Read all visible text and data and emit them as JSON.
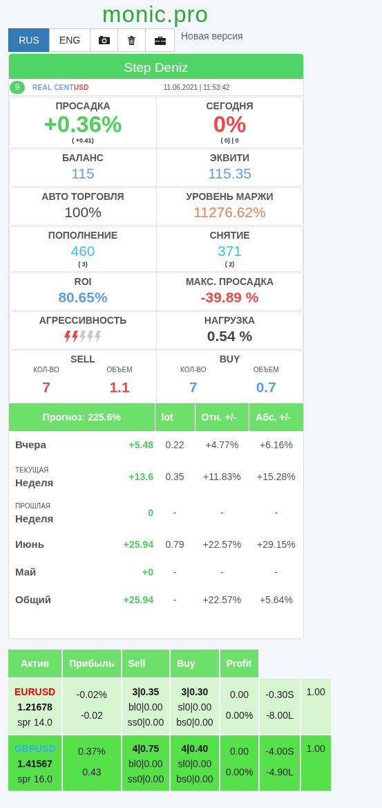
{
  "logo": "monic.pro",
  "toolbar": {
    "languages": [
      {
        "label": "RUS",
        "selected": true
      },
      {
        "label": "ENG",
        "selected": false
      }
    ],
    "link": "Новая версия"
  },
  "account": {
    "name": "Step Deniz",
    "badge": "9",
    "type": "REAL CENT",
    "currency": "USD",
    "datetime": "11.06.2021 | 11:53:42"
  },
  "stats": [
    [
      {
        "kind": "big",
        "label": "ПРОСАДКА",
        "value": "+0.36%",
        "color": "#4cd05a",
        "note": "( +0.41)"
      },
      {
        "kind": "big",
        "label": "СЕГОДНЯ",
        "value": "0%",
        "color": "#f0474b",
        "note": "( 0) | 0"
      }
    ],
    [
      {
        "kind": "value",
        "label": "БАЛАНС",
        "value": "115",
        "color": "#5e9ded"
      },
      {
        "kind": "value",
        "label": "ЭКВИТИ",
        "value": "115.35",
        "color": "#5e9ded"
      }
    ],
    [
      {
        "kind": "value",
        "label": "АВТО ТОРГОВЛЯ",
        "value": "100%",
        "color": "#444444"
      },
      {
        "kind": "value",
        "label": "УРОВЕНЬ МАРЖИ",
        "value": "11276.62%",
        "color": "#f57a55"
      }
    ],
    [
      {
        "kind": "value",
        "label": "ПОПОЛНЕНИЕ",
        "value": "460",
        "color": "#3cc3dc",
        "note": "( 3)"
      },
      {
        "kind": "value",
        "label": "СНЯТИЕ",
        "value": "371",
        "color": "#3cc3dc",
        "note": "( 2)"
      }
    ],
    [
      {
        "kind": "bold",
        "label": "ROI",
        "value": "80.65%",
        "color": "#5e9ded"
      },
      {
        "kind": "bold",
        "label": "МАКС. ПРОСАДКА",
        "value": "-39.89 %",
        "color": "#f0474b"
      }
    ],
    [
      {
        "kind": "bolts",
        "label": "АГРЕССИВНОСТЬ",
        "stars": 2
      },
      {
        "kind": "bold",
        "label": "НАГРУЗКА",
        "value": "0.54 %",
        "color": "#444444"
      }
    ],
    [
      {
        "kind": "orders",
        "label": "SELL",
        "color": "#f0474b",
        "count_label": "КОЛ-ВО",
        "count": "7",
        "volume_label": "ОБЪЕМ",
        "volume": "1.1"
      },
      {
        "kind": "orders",
        "label": "BUY",
        "color": "#5e9ded",
        "count_label": "КОЛ-ВО",
        "count": "7",
        "volume_label": "ОБЪЕМ",
        "volume": "0.7"
      }
    ]
  ],
  "forecast": {
    "columns": [
      "Прогноз: 225.6%",
      "lot",
      "Отн. +/-",
      "Абс. +/-"
    ],
    "rows": [
      {
        "label": "Вчера",
        "profit": "+5.48",
        "lot": "0.22",
        "relative": "+4.77%",
        "absolute": "+6.16%"
      },
      {
        "sublabel": "ТЕКУЩАЯ",
        "label": "Неделя",
        "profit": "+13.6",
        "lot": "0.35",
        "relative": "+11.83%",
        "absolute": "+15.28%"
      },
      {
        "sublabel": "ПРОШЛАЯ",
        "label": "Неделя",
        "profit": "0",
        "lot": "-",
        "relative": "-",
        "absolute": "-"
      },
      {
        "label": "Июнь",
        "profit": "+25.94",
        "lot": "0.79",
        "relative": "+22.57%",
        "absolute": "+29.15%"
      },
      {
        "label": "Май",
        "profit": "+0",
        "lot": "-",
        "relative": "-",
        "absolute": "-"
      },
      {
        "label": "Общий",
        "profit": "+25.94",
        "lot": "-",
        "relative": "+22.57%",
        "absolute": "+5.64%"
      }
    ]
  },
  "assets": {
    "columns": [
      "Актив",
      "Прибыль",
      "Sell",
      "Buy",
      "Profit"
    ],
    "rows": [
      {
        "color": "#d6f5d0",
        "symbol": {
          "text": "EURUSD",
          "color": "#ff0000"
        },
        "price": "1.21678",
        "spread": "spr 14.0",
        "profit_pct": "-0.02%",
        "profit_abs": "-0.02",
        "sell": "3|0.35",
        "sell_bl": "bl0|0.00",
        "sell_ss": "ss0|0.00",
        "buy": "3|0.30",
        "buy_sl": "sl0|0.00",
        "buy_bs": "bs0|0.00",
        "profit": "0.00",
        "profit_pct2": "0.00%",
        "column_6": [
          "-0.30S",
          "-8.00L"
        ],
        "column_7": "1.00"
      },
      {
        "color": "#56e04a",
        "symbol": {
          "text": "GBPUSD",
          "color": "#35aef0"
        },
        "price": "1.41567",
        "spread": "spr 16.0",
        "profit_pct": "0.37%",
        "profit_abs": "0.43",
        "sell": "4|0.75",
        "sell_bl": "bl0|0.00",
        "sell_ss": "ss0|0.00",
        "buy": "4|0.40",
        "buy_sl": "sl0|0.00",
        "buy_bs": "bs0|0.00",
        "profit": "0.00",
        "profit_pct2": "0.00%",
        "column_6": [
          "-4.00S",
          "-4.90L"
        ],
        "column_7": "1.00"
      }
    ]
  }
}
